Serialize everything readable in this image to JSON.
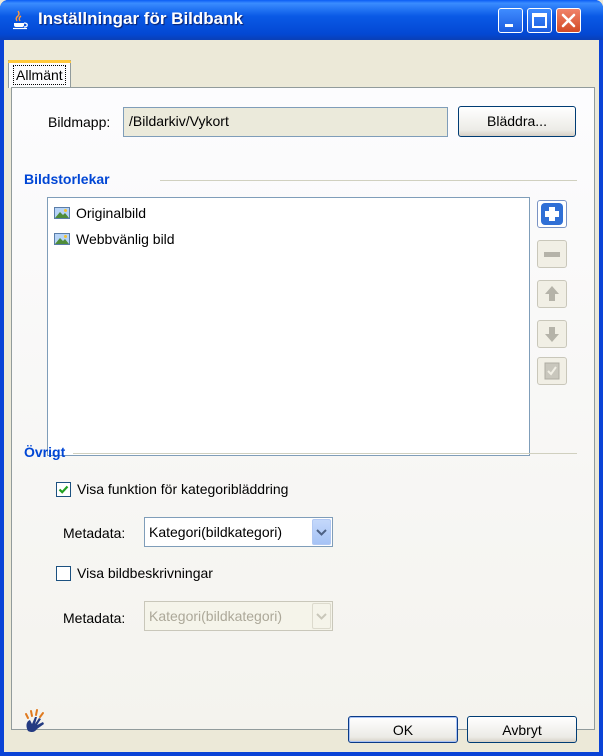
{
  "window": {
    "title": "Inställningar för Bildbank"
  },
  "tabs": [
    {
      "label": "Allmänt"
    }
  ],
  "folder": {
    "label": "Bildmapp:",
    "value": "/Bildarkiv/Vykort",
    "browse_label": "Bläddra..."
  },
  "sizes": {
    "title": "Bildstorlekar",
    "items": [
      {
        "label": "Originalbild"
      },
      {
        "label": "Webbvänlig bild"
      }
    ],
    "buttons": [
      "add-icon",
      "remove-icon",
      "move-up-icon",
      "move-down-icon",
      "edit-icon"
    ]
  },
  "other": {
    "title": "Övrigt",
    "category_browse": {
      "label": "Visa funktion för kategoribläddring",
      "checked": true
    },
    "metadata1": {
      "label": "Metadata:",
      "value": "Kategori(bildkategori)",
      "enabled": true
    },
    "show_descriptions": {
      "label": "Visa bildbeskrivningar",
      "checked": false
    },
    "metadata2": {
      "label": "Metadata:",
      "value": "Kategori(bildkategori)",
      "enabled": false
    }
  },
  "footer": {
    "ok_label": "OK",
    "cancel_label": "Avbryt"
  },
  "colors": {
    "title_bar": "#0a5ae6",
    "section_title": "#0046d5",
    "accent": "#ffc83c"
  }
}
